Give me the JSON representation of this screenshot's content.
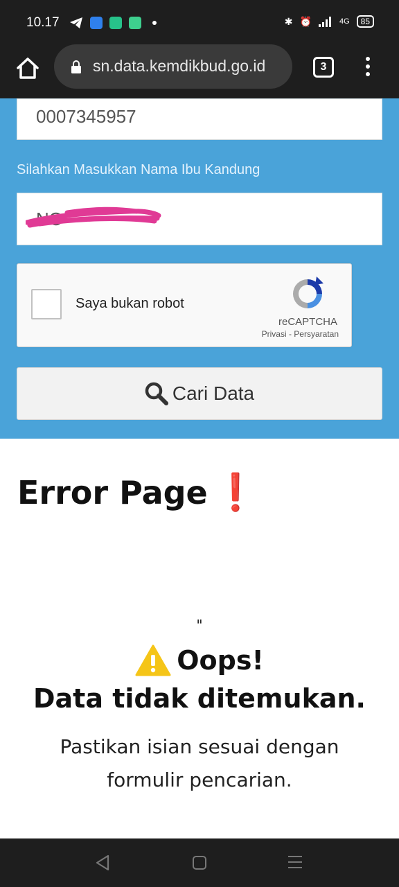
{
  "status_bar": {
    "time": "10.17",
    "network": "4G",
    "battery": "85"
  },
  "browser": {
    "url": "sn.data.kemdikbud.go.id",
    "tab_count": "3"
  },
  "form": {
    "nisn_value": "0007345957",
    "mother_label": "Silahkan Masukkan Nama Ibu Kandung",
    "mother_value": "NO",
    "recaptcha": {
      "label": "Saya bukan robot",
      "brand": "reCAPTCHA",
      "links": "Privasi - Persyaratan"
    },
    "search_button_label": "Cari Data"
  },
  "error": {
    "title": "Error Page",
    "quote": "\"",
    "oops": "Oops!",
    "not_found": "Data tidak ditemukan.",
    "hint": "Pastikan isian sesuai dengan formulir pencarian."
  },
  "colors": {
    "form_bg": "#4aa3d9",
    "warning": "#f5c518",
    "scribble": "#e03a95"
  },
  "icons": [
    "telegram-icon",
    "wifi-icon",
    "signal-icon",
    "alarm-icon",
    "bluetooth-icon",
    "home-icon",
    "lock-icon",
    "search-icon",
    "warning-icon",
    "recaptcha-icon"
  ]
}
